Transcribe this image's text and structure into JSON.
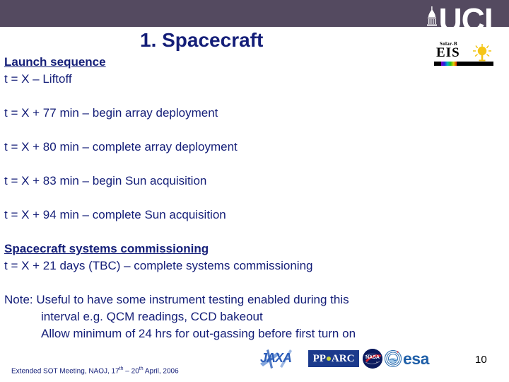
{
  "header": {
    "band_color": "#544a60",
    "ucl_wordmark": "UCL",
    "ucl_icon": "ucl-dome-icon"
  },
  "title": {
    "text": "1. Spacecraft",
    "color": "#141e78"
  },
  "eis_logo": {
    "solarb_label": "Solar-B",
    "wordmark": "EIS",
    "sun_icon": "sun-icon",
    "spectrum_bar": "spectrum-bar"
  },
  "body": {
    "section1_heading": "Launch sequence",
    "lines": [
      "t = X – Liftoff",
      "t = X +  77 min – begin array deployment",
      "t = X +  80 min – complete array deployment",
      "t = X + 83 min – begin Sun acquisition",
      "t = X + 94 min – complete Sun acquisition"
    ],
    "section2_heading": "Spacecraft systems commissioning",
    "section2_line": "t = X + 21 days (TBC) – complete systems commissioning",
    "note_lines": [
      "Note: Useful to have some instrument testing enabled during this",
      "interval e.g. QCM readings, CCD bakeout",
      "Allow minimum of 24 hrs for out-gassing before first turn on"
    ],
    "text_color": "#141e78"
  },
  "footer": {
    "meeting_text_part1": "Extended SOT Meeting, NAOJ, 17",
    "meeting_sup1": "th",
    "meeting_text_part2": " – 20",
    "meeting_sup2": "th",
    "meeting_text_part3": " April, 2006",
    "page_number": "10",
    "logos": {
      "jaxa": "JAXA",
      "pparc_left": "PP",
      "pparc_right": "ARC",
      "nasa": "NASA",
      "esa": "esa"
    }
  }
}
